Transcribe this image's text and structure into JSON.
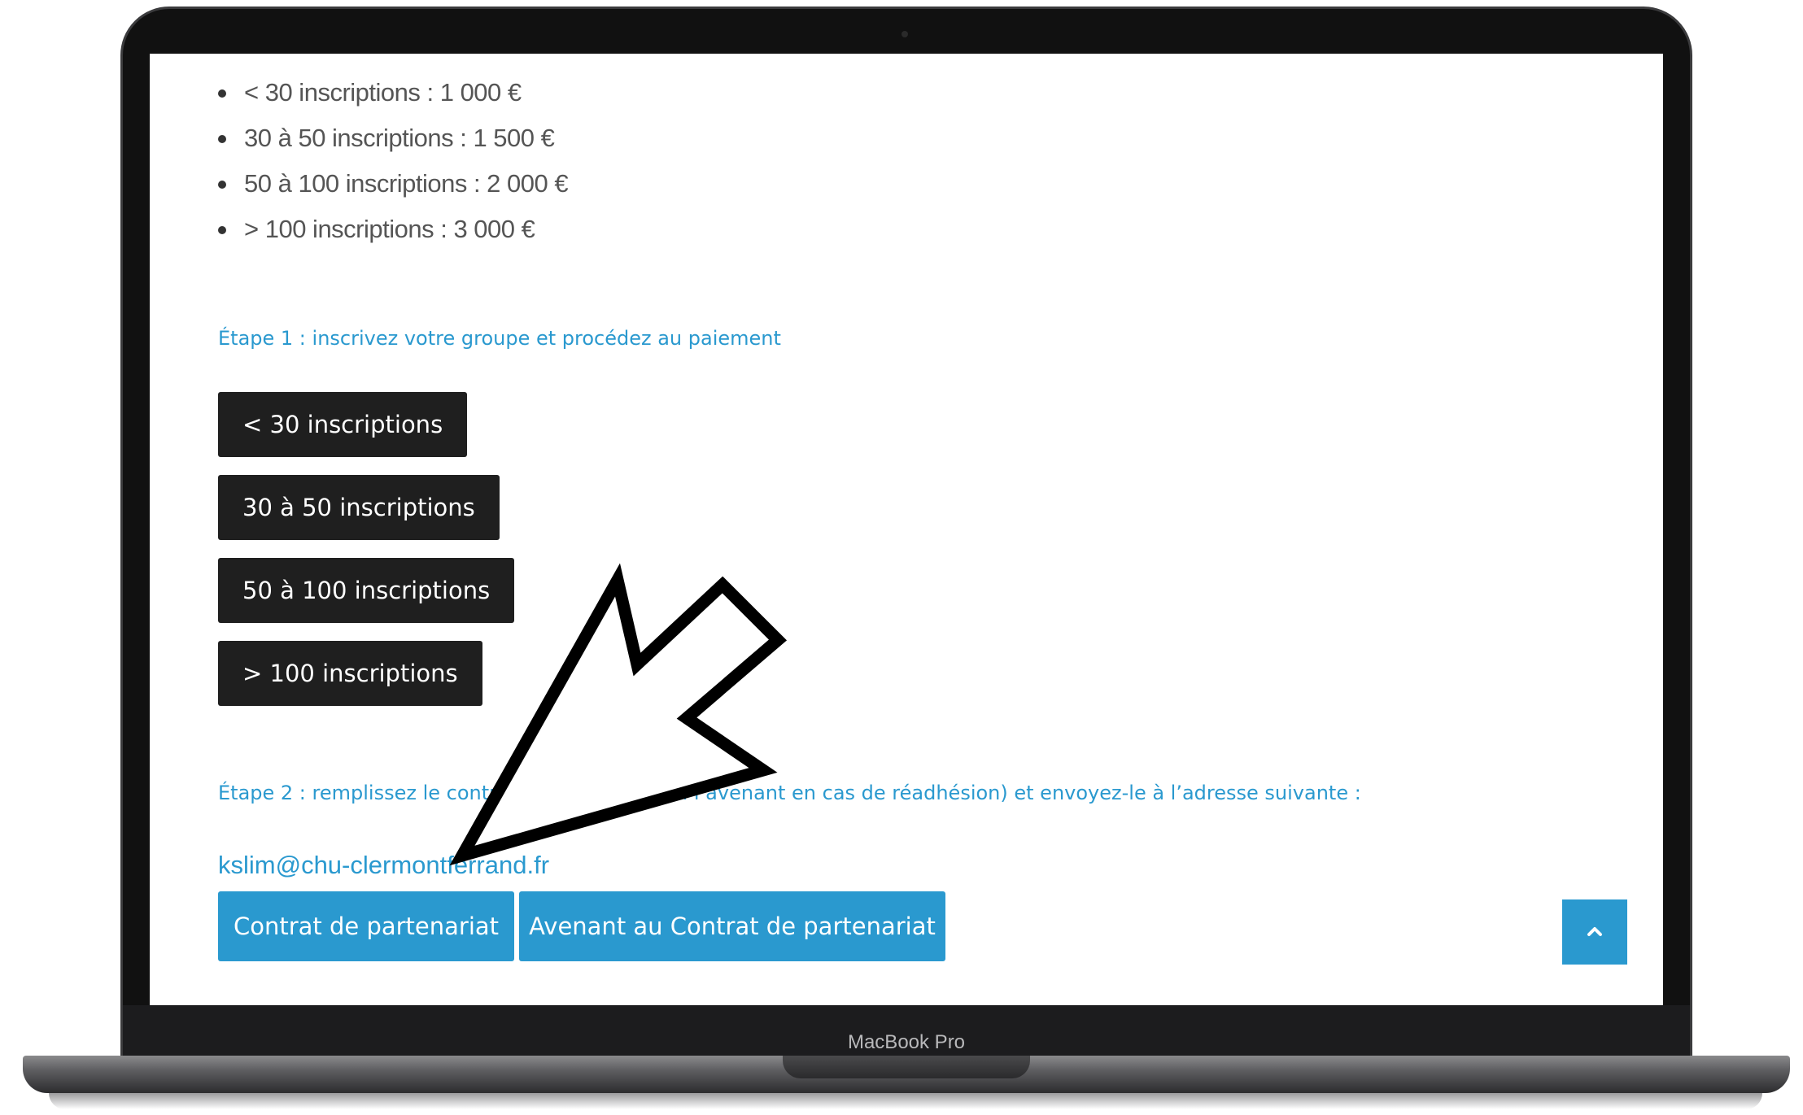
{
  "device": {
    "model_label": "MacBook Pro"
  },
  "pricing": {
    "items": [
      "< 30 inscriptions : 1 000 €",
      "30 à 50 inscriptions : 1 500 €",
      "50 à 100 inscriptions : 2 000 €",
      "> 100 inscriptions : 3 000 €"
    ]
  },
  "step1": {
    "label": "Étape 1 : inscrivez votre groupe et procédez au paiement",
    "buttons": [
      "< 30 inscriptions",
      "30 à 50 inscriptions",
      "50 à 100 inscriptions",
      "> 100 inscriptions"
    ]
  },
  "step2": {
    "label_start": "Étape 2 : remplissez le contr",
    "label_end": "(ou l’avenant en cas de réadhésion) et envoyez-le à l’adresse suivante :",
    "email": "kslim@chu-clermontferrand.fr",
    "contract_button": "Contrat de partenariat",
    "amendment_button": "Avenant au Contrat de partenariat"
  },
  "scroll_top": {
    "icon": "chevron-up-icon"
  },
  "overlay": {
    "icon": "pointer-arrow-icon",
    "color": "#000000"
  },
  "colors": {
    "accent": "#2a99cf",
    "dark_button": "#1f1f1f"
  }
}
